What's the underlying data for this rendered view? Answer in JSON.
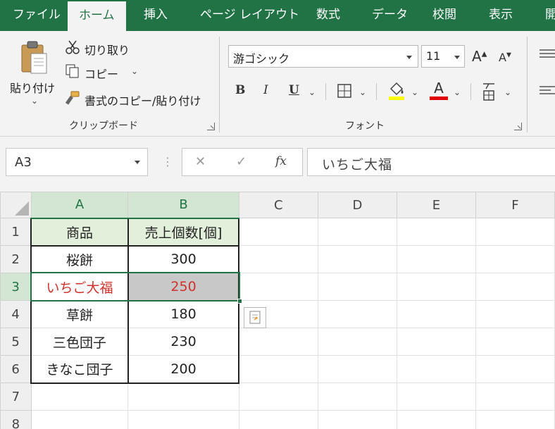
{
  "tabs": [
    "ファイル",
    "ホーム",
    "挿入",
    "ページ レイアウト",
    "数式",
    "データ",
    "校閲",
    "表示",
    "開"
  ],
  "active_tab": "ホーム",
  "clipboard": {
    "paste_label": "貼り付け",
    "cut_label": "切り取り",
    "copy_label": "コピー",
    "format_painter_label": "書式のコピー/貼り付け",
    "group_label": "クリップボード"
  },
  "font": {
    "font_name": "游ゴシック",
    "font_size": "11",
    "bold": "B",
    "italic": "I",
    "underline": "U",
    "grow": "A",
    "shrink": "A",
    "color_glyph": "A",
    "group_label": "フォント"
  },
  "formula_bar": {
    "name_box": "A3",
    "cancel": "✕",
    "enter": "✓",
    "fx": "fx",
    "content": "いちご大福"
  },
  "grid": {
    "columns": [
      "A",
      "B",
      "C",
      "D",
      "E",
      "F"
    ],
    "rows": [
      {
        "num": "1",
        "a": "商品",
        "b": "売上個数[個]"
      },
      {
        "num": "2",
        "a": "桜餅",
        "b": "300"
      },
      {
        "num": "3",
        "a": "いちご大福",
        "b": "250"
      },
      {
        "num": "4",
        "a": "草餅",
        "b": "180"
      },
      {
        "num": "5",
        "a": "三色団子",
        "b": "230"
      },
      {
        "num": "6",
        "a": "きなこ団子",
        "b": "200"
      },
      {
        "num": "7",
        "a": "",
        "b": ""
      },
      {
        "num": "8",
        "a": "",
        "b": ""
      }
    ]
  },
  "colors": {
    "accent": "#217346",
    "header_fill": "#e2efda",
    "highlight_text": "#d0312d",
    "selected_fill": "#c8c8c8",
    "font_color_bar": "#e00000",
    "fill_color_bar": "#ffff00"
  }
}
